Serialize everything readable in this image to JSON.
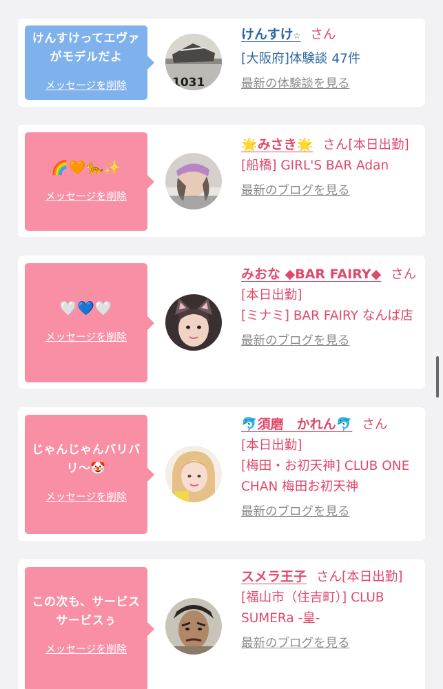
{
  "colors": {
    "background": "#f2f2f4",
    "card": "#ffffff",
    "bubble_blue": "#7fb1ec",
    "bubble_pink": "#f88fa5",
    "text_pink": "#e0496a",
    "text_blue": "#2b66a3",
    "link_gray": "#8a8a8a"
  },
  "messages": [
    {
      "bubble_color": "blue",
      "message_text": "けんすけってエヴァがモデルだよ",
      "delete_label": "メッセージを削除",
      "name": "けんすけ",
      "name_suffix_icon": "☆",
      "honorific": "さん",
      "status": "",
      "detail": "[大阪府]体験談 47件",
      "latest_link": "最新の体験談を見る",
      "avatar_icon": "photo-1031-avatar"
    },
    {
      "bubble_color": "pink",
      "message_text": "🌈🧡🐆✨",
      "delete_label": "メッセージを削除",
      "name": "🌟みさき🌟",
      "honorific": "さん",
      "status": "[本日出勤]",
      "detail": "[船橋] GIRL'S BAR Adan",
      "latest_link": "最新のブログを見る",
      "avatar_icon": "woman-headband-avatar"
    },
    {
      "bubble_color": "pink",
      "message_text": "🤍💙🤍",
      "delete_label": "メッセージを削除",
      "name": "みおな ◆BAR FAIRY◆",
      "honorific": "さん",
      "status": "[本日出勤]",
      "detail": "[ミナミ] BAR FAIRY なんば店",
      "latest_link": "最新のブログを見る",
      "avatar_icon": "cat-ears-avatar"
    },
    {
      "bubble_color": "pink",
      "message_text": "じゃんじゃんバリバリ〜🤡",
      "delete_label": "メッセージを削除",
      "name": "🐬須磨　かれん🐬",
      "honorific": "さん",
      "status": "[本日出勤]",
      "detail": "[梅田・お初天神] CLUB ONE CHAN 梅田お初天神",
      "latest_link": "最新のブログを見る",
      "avatar_icon": "blonde-woman-avatar"
    },
    {
      "bubble_color": "pink",
      "message_text": "この次も、サービスサービスぅ",
      "delete_label": "メッセージを削除",
      "name": "スメラ王子",
      "honorific": "さん",
      "status": "[本日出勤]",
      "detail": "[福山市（住吉町）] CLUB SUMERa -皇-",
      "latest_link": "最新のブログを見る",
      "avatar_icon": "costume-face-avatar"
    }
  ]
}
